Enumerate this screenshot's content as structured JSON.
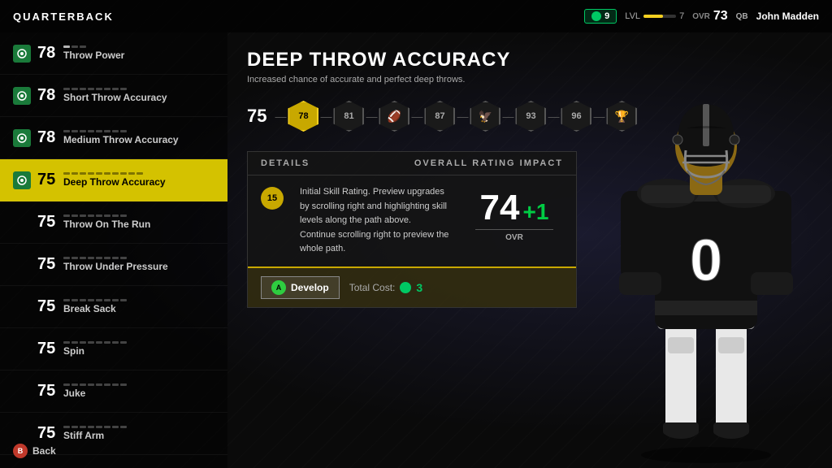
{
  "topbar": {
    "title": "QUARTERBACK",
    "currency": "9",
    "lvl_label": "LVL",
    "lvl_value": "7",
    "ovr_label": "OVR",
    "ovr_value": "73",
    "pos_label": "QB",
    "player_name": "John Madden"
  },
  "skills": [
    {
      "value": "78",
      "name": "Throw Power",
      "dots": 3,
      "filled": 1,
      "has_icon": true
    },
    {
      "value": "78",
      "name": "Short Throw Accuracy",
      "dots": 8,
      "filled": 0,
      "has_icon": true
    },
    {
      "value": "78",
      "name": "Medium Throw Accuracy",
      "dots": 8,
      "filled": 0,
      "has_icon": true
    },
    {
      "value": "75",
      "name": "Deep Throw Accuracy",
      "dots": 10,
      "filled": 10,
      "has_icon": true,
      "active": true
    },
    {
      "value": "75",
      "name": "Throw On The Run",
      "dots": 8,
      "filled": 0,
      "has_icon": false
    },
    {
      "value": "75",
      "name": "Throw Under Pressure",
      "dots": 8,
      "filled": 0,
      "has_icon": false
    },
    {
      "value": "75",
      "name": "Break Sack",
      "dots": 8,
      "filled": 0,
      "has_icon": false
    },
    {
      "value": "75",
      "name": "Spin",
      "dots": 8,
      "filled": 0,
      "has_icon": false
    },
    {
      "value": "75",
      "name": "Juke",
      "dots": 8,
      "filled": 0,
      "has_icon": false
    },
    {
      "value": "75",
      "name": "Stiff Arm",
      "dots": 8,
      "filled": 0,
      "has_icon": false
    }
  ],
  "main": {
    "skill_title": "DEEP THROW ACCURACY",
    "skill_desc": "Increased chance of accurate and perfect deep throws.",
    "path_start": "75",
    "path_nodes": [
      {
        "value": "78",
        "type": "number"
      },
      {
        "value": "81",
        "type": "number"
      },
      {
        "value": "🏈",
        "type": "icon"
      },
      {
        "value": "87",
        "type": "number"
      },
      {
        "value": "🦅",
        "type": "icon"
      },
      {
        "value": "93",
        "type": "number"
      },
      {
        "value": "96",
        "type": "number"
      },
      {
        "value": "🏆",
        "type": "icon"
      }
    ],
    "details_label": "DETAILS",
    "ovr_impact_label": "OVERALL RATING IMPACT",
    "details_text": "Initial Skill Rating. Preview upgrades by scrolling right and highlighting skill levels along the path above. Continue scrolling right to preview the whole path.",
    "current_level": "15",
    "ovr_current": "74",
    "ovr_plus": "+1",
    "ovr_sub": "OVR",
    "develop_label": "Develop",
    "total_cost_label": "Total Cost:",
    "total_cost_value": "3"
  },
  "footer": {
    "back_label": "Back"
  },
  "colors": {
    "active_skill": "#d4c200",
    "icon_bg": "#1a7a3a",
    "accent_green": "#00c864",
    "ovr_plus_color": "#00cc44"
  }
}
